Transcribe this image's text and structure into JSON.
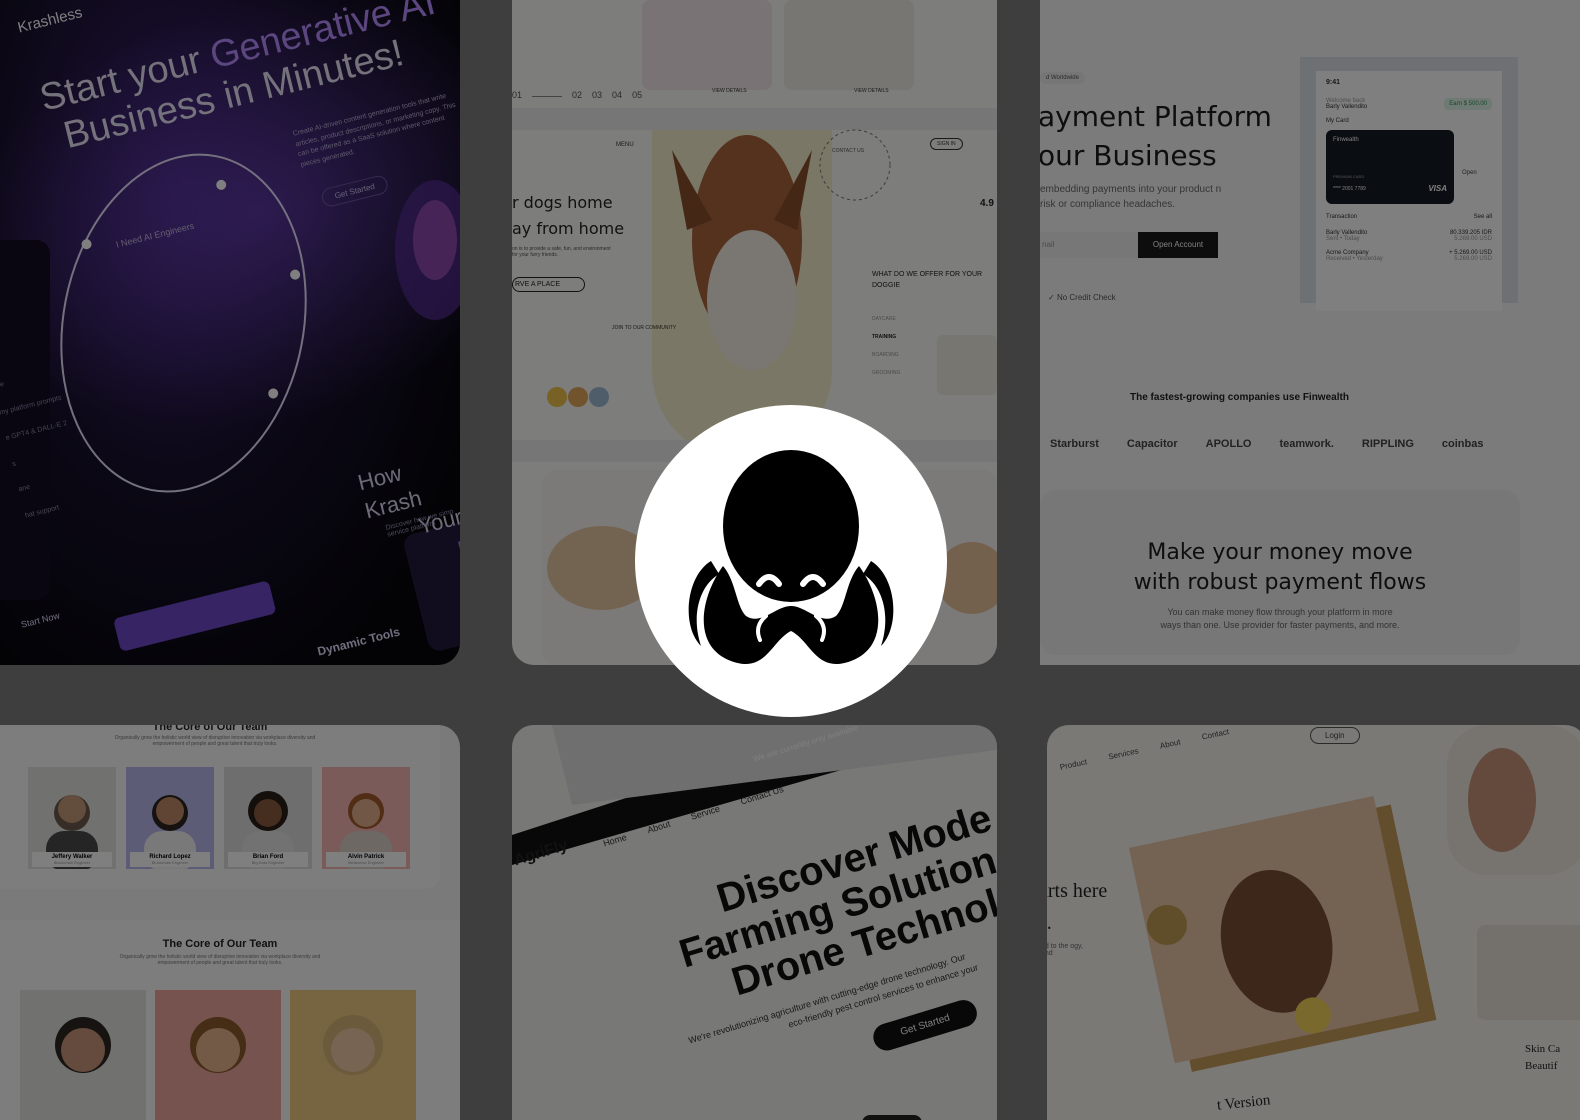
{
  "ai_tile": {
    "brand": "Krashless",
    "headline_1": "Start your",
    "headline_accent": "Generative AI",
    "headline_2": "Business in Minutes!",
    "body": "Create AI-driven content generation tools that write articles, product descriptions, or marketing copy. This can be offered as a SaaS solution where content pieces generated.",
    "cta": "Get Started",
    "engineers": "I Need AI Engineers",
    "how_1": "How Krash",
    "how_2": "Your",
    "how_body": "Discover how we simp service platform",
    "start_now": "Start Now",
    "dynamic_tools": "Dynamic Tools",
    "side_items": [
      "nce",
      "my platform prompts",
      "e GPT4 & DALL-E 2",
      "s",
      "ane",
      "hat support"
    ]
  },
  "dog_tile": {
    "view_details": "VIEW DETAILS",
    "pager": [
      "01",
      "02",
      "03",
      "04",
      "05"
    ],
    "menu": "MENU",
    "sign_in": "SIGN IN",
    "headline_1": "r dogs home",
    "headline_2": "ay from home",
    "body": "on is to provide a safe, fun, and environment for your furry friends.",
    "reserve": "RVE A PLACE",
    "join": "JOIN TO OUR COMMUNITY",
    "contact_badge": "CONTACT US",
    "rating": "4.9",
    "offer_title": "WHAT DO WE OFFER FOR YOUR DOGGIE",
    "offer_items": [
      "DAYCARE",
      "TRAINING",
      "BOARDING",
      "GROOMING"
    ]
  },
  "pay_tile": {
    "badge": "d Worldwide",
    "headline_1": "ayment Platform",
    "headline_2": "our Business",
    "body": "embedding payments into your product n risk or compliance headaches.",
    "email_placeholder": "nail",
    "open_account": "Open Account",
    "no_credit": "No Credit Check",
    "phone": {
      "time": "9:41",
      "welcome": "Welcome back",
      "user": "Barly Vallendito",
      "earn": "Earn $ 500.00",
      "my_card": "My Card",
      "card_brand": "Finwealth",
      "card_label": "PREMIUM CARD",
      "card_number": "**** 2001 7789",
      "card_network": "VISA",
      "open": "Open",
      "transaction": "Transaction",
      "see_all": "See all",
      "tx": [
        {
          "name": "Barly Vallendito",
          "sub": "Sent • Today",
          "amount": "80.339.205 IDR",
          "amount2": "5.269.00 USD"
        },
        {
          "name": "Acme Company",
          "sub": "Received • Yesterday",
          "amount": "+ 5.269.00 USD",
          "amount2": "5.269.00 USD"
        }
      ]
    },
    "companies_title": "The fastest-growing companies use Finwealth",
    "companies": [
      "Starburst",
      "Capacitor",
      "APOLLO",
      "teamwork.",
      "RIPPLING",
      "coinbas"
    ],
    "money_1": "Make your money move",
    "money_2": "with robust payment flows",
    "money_body_1": "You can make money flow through your platform in more",
    "money_body_2": "ways than one. Use provider for faster payments, and more."
  },
  "team_tile": {
    "title_top": "The Core of Our Team",
    "desc": "Organically grow the holistic world view of disruptive innovation via workplace diversity and empowerment of people and great talent that truly looks.",
    "members": [
      {
        "name": "Jeffery Walker",
        "role": "Blockchain Engineer",
        "bg": "#e2e2e0"
      },
      {
        "name": "Richard Lopez",
        "role": "Blockchain Engineer",
        "bg": "#b9b8ee"
      },
      {
        "name": "Brian Ford",
        "role": "Big Data Engineer",
        "bg": "#dcdcdc"
      },
      {
        "name": "Alvin Patrick",
        "role": "Metaverse Engineer",
        "bg": "#f4b6b4"
      }
    ],
    "title_bottom": "The Core of Our Team"
  },
  "drone_tile": {
    "marquee": "We are currently only available",
    "brand": "AgriFly",
    "nav": [
      "Home",
      "About",
      "Service",
      "Contact Us"
    ],
    "headline_1": "Discover Mode",
    "headline_2": "Farming Solution",
    "headline_3": "Drone Technol",
    "body_1": "We're revolutionizing agriculture with cutting-edge drone technology. Our",
    "body_2": "eco-friendly pest control services to enhance your",
    "cta": "Get Started"
  },
  "skin_tile": {
    "login": "Login",
    "nav": [
      "Product",
      "Services",
      "About",
      "Contact"
    ],
    "headline": "arts here",
    "headline_2": "s.",
    "body": "ad to the ogy, and",
    "side_1": "Skin Ca",
    "side_2": "Beautif",
    "version": "t Version"
  },
  "colors": {
    "ai_accent": "#9b6cf2",
    "dark_button": "#1b1b1b",
    "overlay": "rgba(0,0,0,0.5)"
  },
  "center_logo": {
    "icon": "octopus-logo-icon"
  }
}
